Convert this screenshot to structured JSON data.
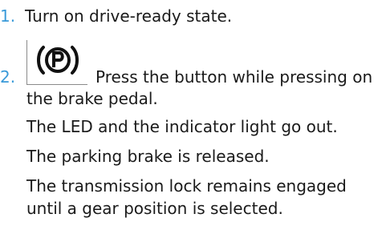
{
  "colors": {
    "step_number": "#3a9ad9",
    "text": "#1a1a1a",
    "button_border": "#8a8a8a"
  },
  "steps": [
    {
      "number": "1.",
      "text": "Turn on drive-ready state."
    },
    {
      "number": "2.",
      "icon": "parking-brake-p-icon",
      "icon_label": "(P)",
      "text_line1": "Press the button while pressing on",
      "text_line2": "the brake pedal."
    }
  ],
  "results": [
    "The LED and the indicator light go out.",
    "The parking brake is released.",
    "The transmission lock remains engaged",
    "until a gear position is selected."
  ]
}
